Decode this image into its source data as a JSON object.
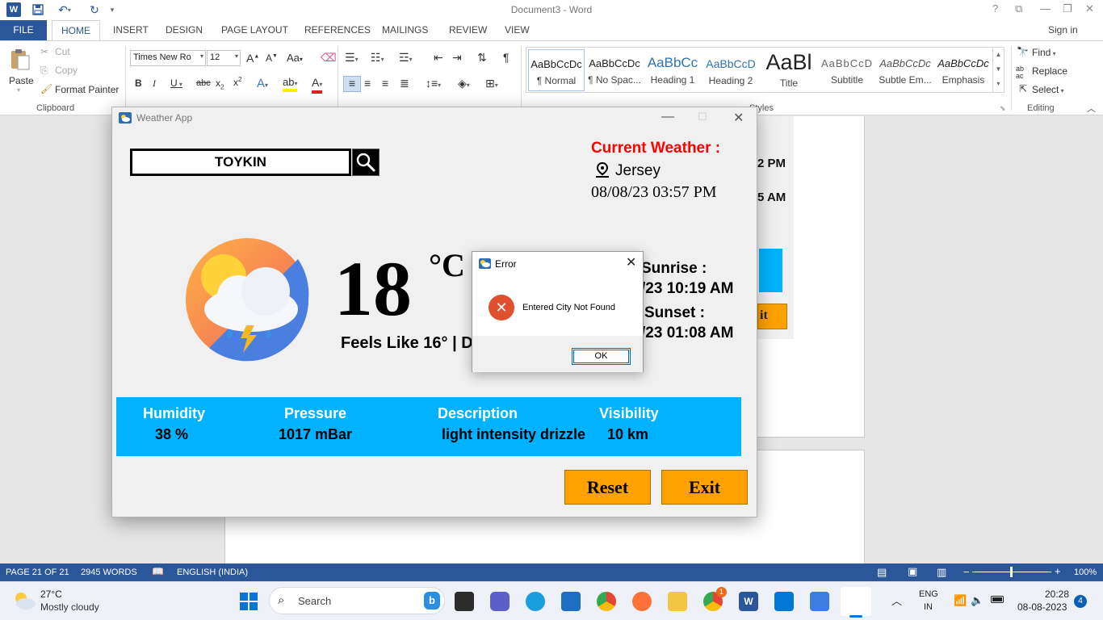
{
  "word": {
    "doc_title": "Document3 - Word",
    "tabs": [
      "FILE",
      "HOME",
      "INSERT",
      "DESIGN",
      "PAGE LAYOUT",
      "REFERENCES",
      "MAILINGS",
      "REVIEW",
      "VIEW"
    ],
    "sign_in": "Sign in",
    "clipboard": {
      "paste": "Paste",
      "cut": "Cut",
      "copy": "Copy",
      "format_painter": "Format Painter",
      "group": "Clipboard"
    },
    "font": {
      "name": "Times New Ro",
      "size": "12"
    },
    "styles": [
      {
        "preview": "AaBbCcDc",
        "name": "¶ Normal"
      },
      {
        "preview": "AaBbCcDc",
        "name": "¶ No Spac..."
      },
      {
        "preview": "AaBbCc",
        "name": "Heading 1"
      },
      {
        "preview": "AaBbCcD",
        "name": "Heading 2"
      },
      {
        "preview": "AaBl",
        "name": "Title"
      },
      {
        "preview": "AaBbCcD",
        "name": "Subtitle"
      },
      {
        "preview": "AaBbCcDc",
        "name": "Subtle Em..."
      },
      {
        "preview": "AaBbCcDc",
        "name": "Emphasis"
      }
    ],
    "styles_group": "Styles",
    "editing": {
      "find": "Find",
      "replace": "Replace",
      "select": "Select",
      "group": "Editing"
    },
    "status": {
      "page": "PAGE 21 OF 21",
      "words": "2945 WORDS",
      "language": "ENGLISH (INDIA)",
      "zoom": "100%"
    },
    "bg_fragments": {
      "t1": "2 PM",
      "t2": "5 AM",
      "btn": "it"
    }
  },
  "weather_app": {
    "title": "Weather App",
    "city_input": "TOYKIN",
    "current_weather_label": "Current Weather :",
    "location": "Jersey",
    "datetime": "08/08/23  03:57 PM",
    "temperature": "18",
    "unit": "°C",
    "feels_like": "Feels Like 16° | D",
    "sunrise_label": "Sunrise :",
    "sunrise_value": "/23  10:19 AM",
    "sunset_label": "Sunset :",
    "sunset_value": "/23  01:08 AM",
    "stats": {
      "humidity_label": "Humidity",
      "humidity_value": "38 %",
      "pressure_label": "Pressure",
      "pressure_value": "1017 mBar",
      "description_label": "Description",
      "description_value": "light intensity drizzle",
      "visibility_label": "Visibility",
      "visibility_value": "10 km"
    },
    "reset_label": "Reset",
    "exit_label": "Exit",
    "colors": {
      "accent_blue": "#00b2ff",
      "button_orange": "#ffa200",
      "title_red": "#ff0000"
    }
  },
  "error_dialog": {
    "title": "Error",
    "message": "Entered City Not Found",
    "ok_label": "OK"
  },
  "taskbar": {
    "weather_temp": "27°C",
    "weather_desc": "Mostly cloudy",
    "search_placeholder": "Search",
    "lang_top": "ENG",
    "lang_bottom": "IN",
    "time": "20:28",
    "date": "08-08-2023",
    "notif_count": "4",
    "chrome_badge": "1"
  }
}
